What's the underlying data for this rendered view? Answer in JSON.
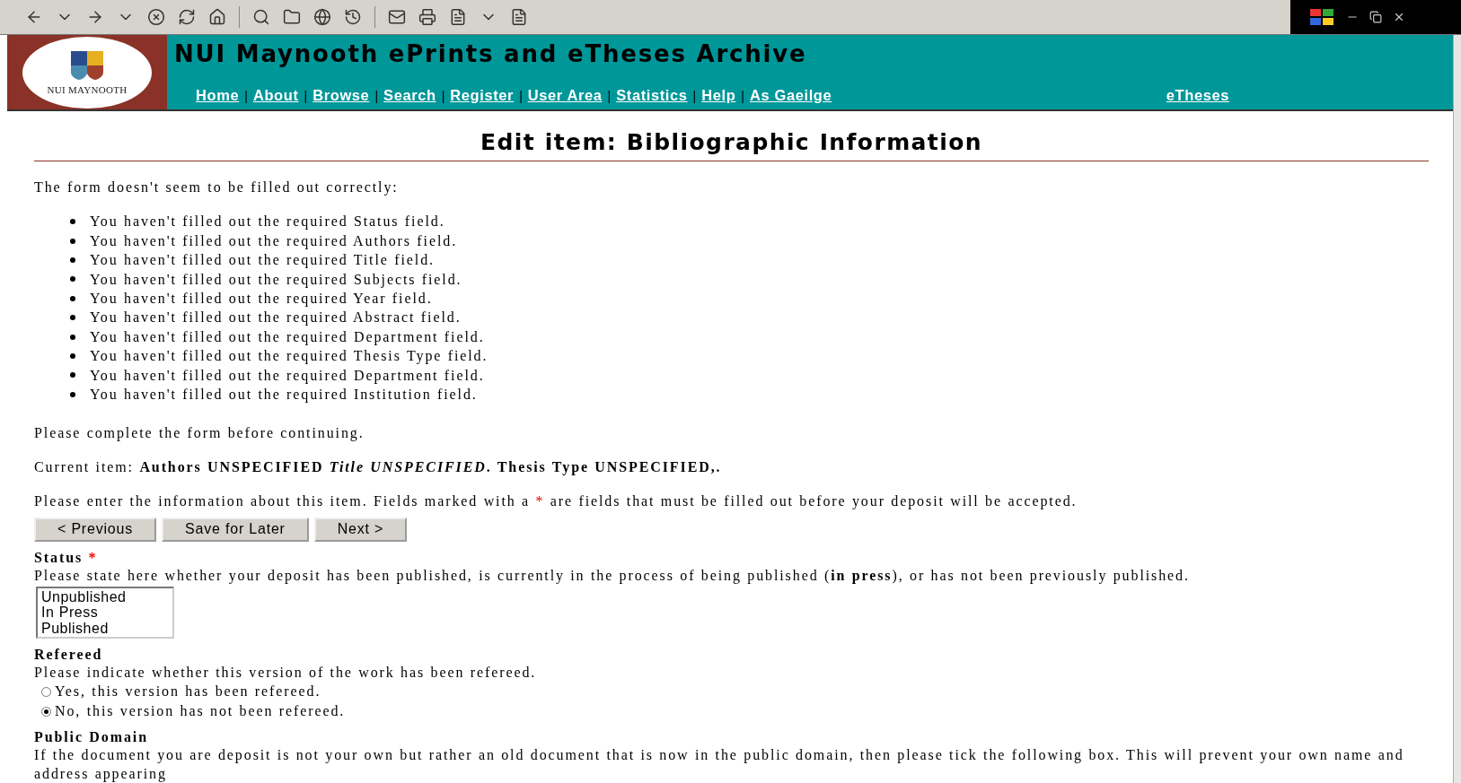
{
  "header": {
    "logo_text": "NUI MAYNOOTH",
    "title": "NUI Maynooth ePrints and eTheses Archive",
    "nav": [
      "Home",
      "About",
      "Browse",
      "Search",
      "Register",
      "User Area",
      "Statistics",
      "Help",
      "As Gaeilge"
    ],
    "separator": "|",
    "side_link": "eTheses"
  },
  "heading": "Edit item: Bibliographic Information",
  "errors": {
    "intro": "The form doesn't seem to be filled out correctly:",
    "items": [
      "You haven't filled out the required Status field.",
      "You haven't filled out the required Authors field.",
      "You haven't filled out the required Title field.",
      "You haven't filled out the required Subjects field.",
      "You haven't filled out the required Year field.",
      "You haven't filled out the required Abstract field.",
      "You haven't filled out the required Department field.",
      "You haven't filled out the required Thesis Type field.",
      "You haven't filled out the required Department field.",
      "You haven't filled out the required Institution field."
    ],
    "outro": "Please complete the form before continuing."
  },
  "current_item": {
    "label": "Current item:",
    "value": "Authors UNSPECIFIED *Title UNSPECIFIED*. Thesis Type UNSPECIFIED,."
  },
  "instructions": {
    "before": "Please enter the information about this item. Fields marked with a",
    "mark": "*",
    "after": "are fields that must be filled out before your deposit will be accepted."
  },
  "buttons": [
    "< Previous",
    "Save for Later",
    "Next >"
  ],
  "fields": [
    {
      "kind": "select",
      "label": "Status",
      "required": true,
      "help": "Please state here whether your deposit has been published, is currently in the process of being published (**in press**), or has not been previously published.",
      "options": [
        {
          "label": "Unpublished",
          "selected": false
        },
        {
          "label": "In Press",
          "selected": false
        },
        {
          "label": "Published",
          "selected": false
        }
      ]
    },
    {
      "kind": "radio",
      "label": "Refereed",
      "required": false,
      "help": "Please indicate whether this version of the work has been refereed.",
      "options": [
        {
          "label": "Yes, this version has been refereed.",
          "selected": false
        },
        {
          "label": "No, this version has not been refereed.",
          "selected": true
        }
      ]
    },
    {
      "kind": "text",
      "label": "Public Domain",
      "required": false,
      "help": "If the document you are deposit is not your own but rather an old document that is now in the public domain, then please tick the following box. This will prevent your own name and address appearing"
    }
  ]
}
